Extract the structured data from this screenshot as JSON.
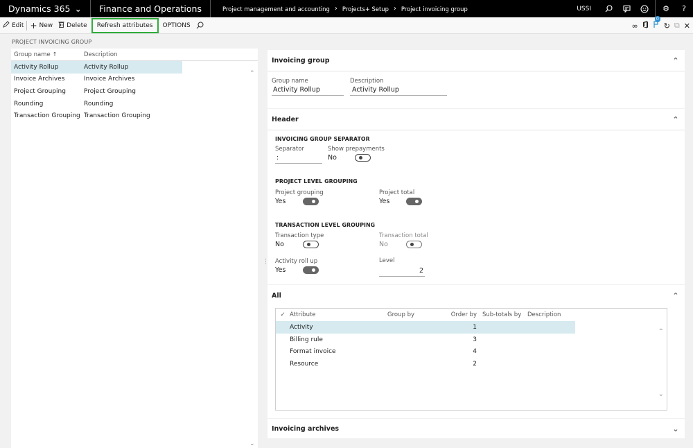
{
  "topbar": {
    "brand": "Dynamics 365",
    "app": "Finance and Operations",
    "breadcrumb": [
      "Project management and accounting",
      "Projects+ Setup",
      "Project invoicing group"
    ],
    "company": "USSI"
  },
  "actions": {
    "edit": "Edit",
    "new": "New",
    "delete": "Delete",
    "refresh": "Refresh attributes",
    "options": "OPTIONS"
  },
  "list": {
    "title": "PROJECT INVOICING GROUP",
    "col_name": "Group name",
    "col_desc": "Description",
    "rows": [
      {
        "name": "Activity Rollup",
        "desc": "Activity Rollup"
      },
      {
        "name": "Invoice Archives",
        "desc": "Invoice Archives"
      },
      {
        "name": "Project Grouping",
        "desc": "Project Grouping"
      },
      {
        "name": "Rounding",
        "desc": "Rounding"
      },
      {
        "name": "Transaction Grouping",
        "desc": "Transaction Grouping"
      }
    ]
  },
  "invoicing_group": {
    "title": "Invoicing group",
    "group_name_label": "Group name",
    "group_name": "Activity Rollup",
    "description_label": "Description",
    "description": "Activity Rollup"
  },
  "header": {
    "title": "Header",
    "separator_section": "INVOICING GROUP SEPARATOR",
    "separator_label": "Separator",
    "separator_value": ":",
    "show_prepayments_label": "Show prepayments",
    "show_prepayments_value": "No",
    "project_section": "PROJECT LEVEL GROUPING",
    "project_grouping_label": "Project grouping",
    "project_grouping_value": "Yes",
    "project_total_label": "Project total",
    "project_total_value": "Yes",
    "transaction_section": "TRANSACTION LEVEL GROUPING",
    "transaction_type_label": "Transaction type",
    "transaction_type_value": "No",
    "transaction_total_label": "Transaction total",
    "transaction_total_value": "No",
    "activity_rollup_label": "Activity roll up",
    "activity_rollup_value": "Yes",
    "level_label": "Level",
    "level_value": "2"
  },
  "all": {
    "title": "All",
    "columns": [
      "Attribute",
      "Group by",
      "Order by",
      "Sub-totals by",
      "Description"
    ],
    "rows": [
      {
        "attribute": "Activity",
        "order": "1"
      },
      {
        "attribute": "Billing rule",
        "order": "3"
      },
      {
        "attribute": "Format invoice",
        "order": "4"
      },
      {
        "attribute": "Resource",
        "order": "2"
      }
    ]
  },
  "invoicing_archives": {
    "title": "Invoicing archives"
  }
}
